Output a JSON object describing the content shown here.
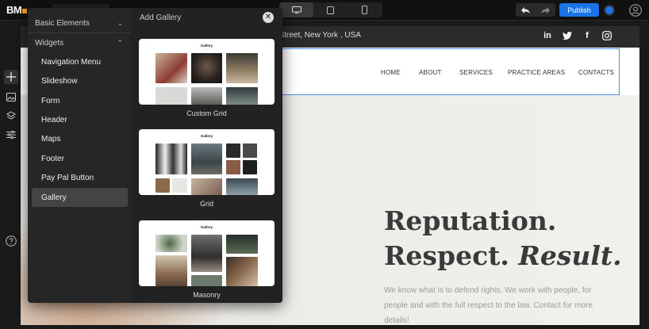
{
  "app": {
    "logo": "BM",
    "publish_label": "Publish"
  },
  "toolbar": {
    "devices": [
      "desktop-icon",
      "tablet-icon",
      "mobile-icon"
    ],
    "active_device": "desktop",
    "undo_icon": "undo-icon",
    "redo_icon": "redo-icon"
  },
  "sidebar_tools": [
    "plus-icon",
    "image-icon",
    "layers-icon",
    "sliders-icon",
    "help-icon"
  ],
  "panel": {
    "basic_label": "Basic Elements",
    "widgets_label": "Widgets",
    "items": [
      {
        "label": "Navigation Menu"
      },
      {
        "label": "Slideshow"
      },
      {
        "label": "Form"
      },
      {
        "label": "Header"
      },
      {
        "label": "Maps"
      },
      {
        "label": "Footer"
      },
      {
        "label": "Pay Pal Button"
      },
      {
        "label": "Gallery",
        "active": true
      }
    ],
    "add_title": "Add Gallery",
    "gallery_options": [
      {
        "label": "Custom Grid",
        "card_title": "Gallery"
      },
      {
        "label": "Grid",
        "card_title": "Gallery"
      },
      {
        "label": "Masonry",
        "card_title": "Gallery"
      }
    ]
  },
  "site": {
    "address": "t Street, New York , USA",
    "social": [
      "linkedin-icon",
      "twitter-icon",
      "facebook-icon",
      "instagram-icon"
    ],
    "nav": [
      "HOME",
      "ABOUT",
      "SERVICES",
      "PRACTICE AREAS",
      "CONTACTS"
    ],
    "headline_line1": "Reputation.",
    "headline_line2a": "Respect. ",
    "headline_line2b": "Result.",
    "body": "We know what is to defend rights. We work with people, for people and with the full respect to the law. Contact for more details!"
  },
  "colors": {
    "accent": "#1a73e8",
    "selection": "#4a90e2",
    "panel_bg": "#222222"
  }
}
